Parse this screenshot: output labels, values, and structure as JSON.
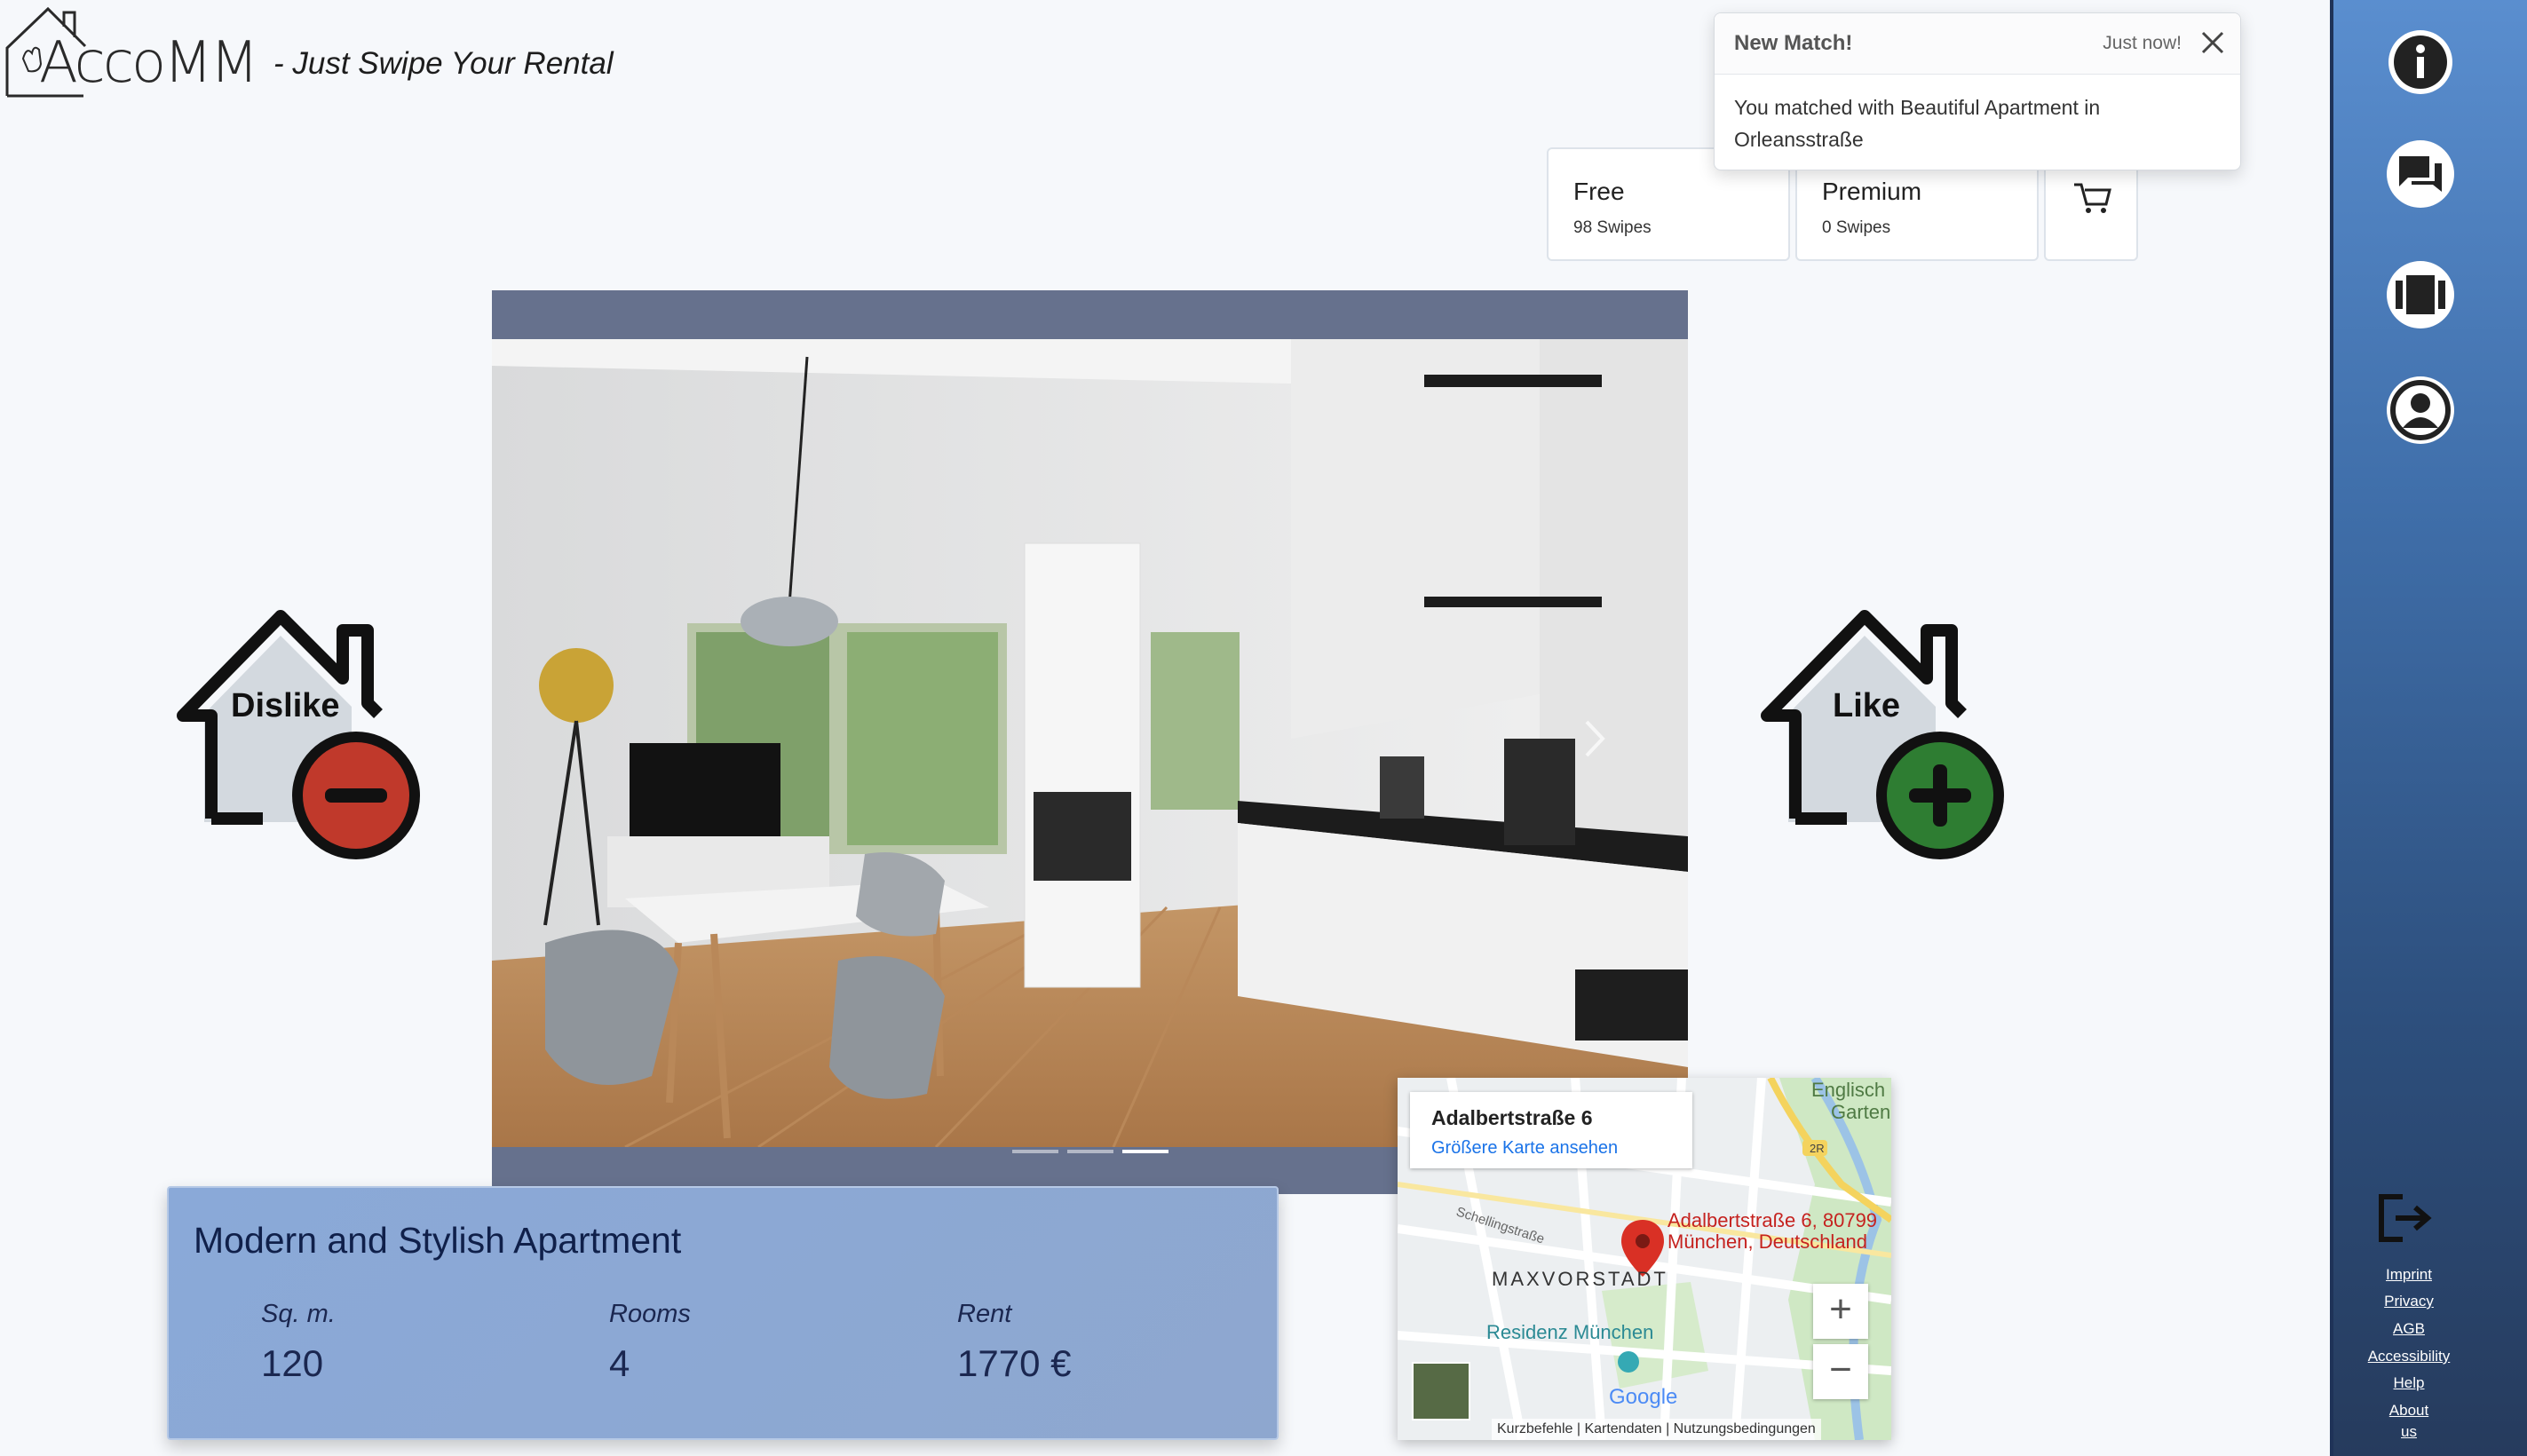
{
  "header": {
    "brand_text": "AccoMM",
    "tagline": "- Just Swipe Your Rental"
  },
  "plans": [
    {
      "name": "Free",
      "swipes": "98 Swipes"
    },
    {
      "name": "Premium",
      "swipes": "0 Swipes"
    }
  ],
  "toast": {
    "title": "New Match!",
    "time": "Just now!",
    "message": "You matched with Beautiful Apartment in Orleansstraße"
  },
  "actions": {
    "dislike": "Dislike",
    "like": "Like"
  },
  "listing": {
    "title": "Modern and Stylish Apartment",
    "stats": [
      {
        "label": "Sq. m.",
        "value": "120"
      },
      {
        "label": "Rooms",
        "value": "4"
      },
      {
        "label": "Rent",
        "value": "1770 €"
      }
    ]
  },
  "map": {
    "address": "Adalbertstraße 6",
    "link": "Größere Karte ansehen",
    "pin_line1": "Adalbertstraße 6, 80799",
    "pin_line2": "München, Deutschland",
    "district": "MAXVORSTADT",
    "poi": "Residenz München",
    "park_line1": "Englisch",
    "park_line2": "Garten",
    "street": "Schellingstraße",
    "road_badge": "2R",
    "google": "Google",
    "footer": {
      "shortcuts": "Kurzbefehle",
      "mapdata": "Kartendaten",
      "terms": "Nutzungsbedingungen"
    }
  },
  "sidebar": {
    "icons": [
      "info-icon",
      "chat-icon",
      "cards-icon",
      "profile-icon",
      "logout-icon"
    ],
    "links": [
      "Imprint",
      "Privacy",
      "AGB",
      "Accessibility",
      "Help",
      "About",
      "us"
    ]
  },
  "colors": {
    "dislike": "#c0392b",
    "like": "#2e7d32",
    "card_bg": "#8aa9d8",
    "sidebar_top": "#5a8ecf",
    "sidebar_bottom": "#263b5d"
  }
}
